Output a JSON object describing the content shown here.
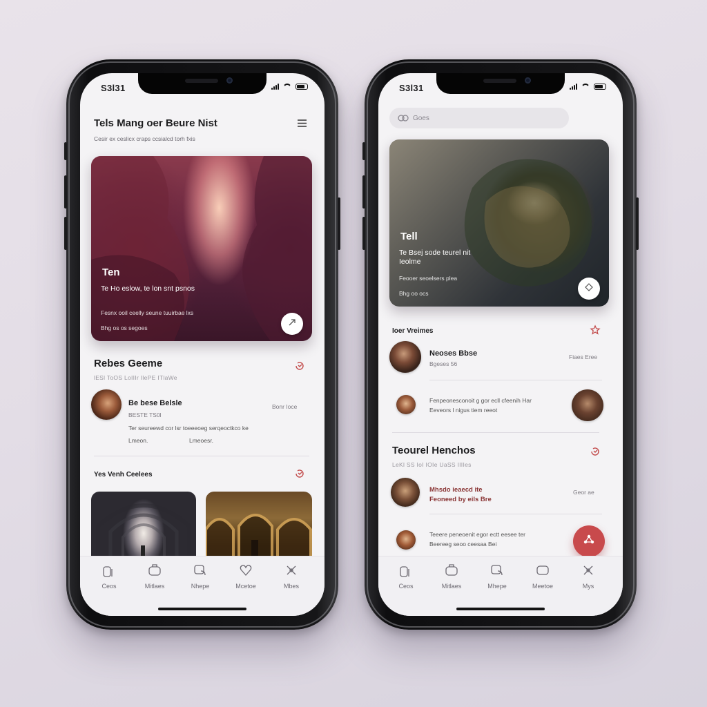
{
  "phone1": {
    "status_time": "S3l31",
    "page_title": "Tels Mang oer Beure Nist",
    "page_subtitle": "Cesir ex ceslicx craps ccsialcd torh fxis",
    "hero": {
      "title": "Ten",
      "subtitle": "Te Ho eslow, te lon snt psnos",
      "line1": "Fesnx ooil ceelly seune tuuirbae lxs",
      "line2": "Bhg os os segoes"
    },
    "section1": {
      "title": "Rebes Geeme",
      "subtitle": "lESl ToOS LoIIIr IlePE ITlaWe",
      "item": {
        "name": "Be bese Belsle",
        "meta": "BESTE TS0l",
        "side": "Bonr Ioce",
        "body_line1": "Ter seureewd cor lsr toeeeoeg serqeoctkco ke",
        "body_col1": "Lmeon.",
        "body_col2": "Lmeoesr."
      }
    },
    "section2": {
      "title": "Yes Venh Ceelees"
    },
    "tabs": [
      "Ceos",
      "Mitlaes",
      "Nhepe",
      "Mcetoe",
      "Mbes"
    ]
  },
  "phone2": {
    "status_time": "S3l31",
    "search_placeholder": "Goes",
    "hero": {
      "title": "Tell",
      "subtitle": "Te Bsej sode teurel nit Ieolme",
      "line1": "Feooer seoelsers plea",
      "line2": "Bhg oo ocs"
    },
    "section1": {
      "title": "Ioer Vreimes",
      "item1": {
        "name": "Neoses Bbse",
        "meta": "Bgeses 56",
        "side": "Fiaes Eree"
      },
      "item2": {
        "line1": "Fenpeonesconoit g gor ecll cfeenih Har",
        "line2": "Eeveors l nigus tiem reeot"
      }
    },
    "section2": {
      "title": "Teourel Henchos",
      "subtitle": "LeKl SS IoI IOIe UaSS IIIIes",
      "item1": {
        "line1": "Mhsdo ieaecd ite",
        "line2": "Feoneed by eils Bre",
        "side": "Geor ae"
      },
      "item2": {
        "line1": "Teeere peneoenit egor ectt eesee ter",
        "line2": "Beereeg seoo ceesaa Bei"
      }
    },
    "tabs": [
      "Ceos",
      "Mitlaes",
      "Mhepe",
      "Meetoe",
      "Mys"
    ]
  },
  "colors": {
    "accent_red": "#c24a4a",
    "screen_bg": "#f4f3f5",
    "page_bg": "#e6e0e8"
  },
  "icons": {
    "phone1": [
      "menu-icon",
      "share-icon",
      "refresh-icon",
      "refresh-icon"
    ],
    "phone2": [
      "search-icon",
      "share-icon",
      "star-icon",
      "refresh-icon",
      "network-icon"
    ],
    "tabs": [
      "home-icon",
      "bag-icon",
      "chat-icon",
      "heart-icon",
      "profile-icon"
    ]
  }
}
